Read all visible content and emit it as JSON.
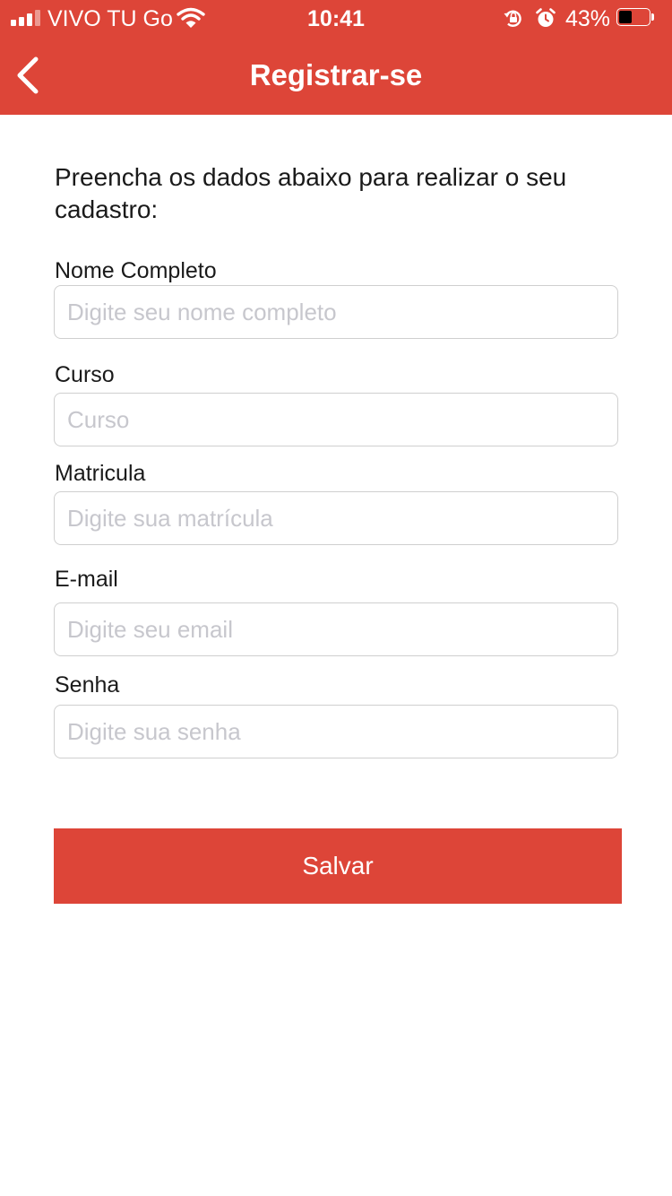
{
  "status_bar": {
    "carrier": "VIVO TU Go",
    "time": "10:41",
    "battery_percent": "43%",
    "battery_level": 0.43,
    "signal_bars_active": 3,
    "signal_bars_total": 4,
    "icons": [
      "signal-icon",
      "wifi-icon",
      "rotation-lock-icon",
      "alarm-icon",
      "battery-icon"
    ]
  },
  "nav": {
    "title": "Registrar-se",
    "back_icon": "chevron-left-icon"
  },
  "form": {
    "intro": "Preencha os dados abaixo para realizar o seu cadastro:",
    "fields": [
      {
        "label": "Nome Completo",
        "placeholder": "Digite seu nome completo",
        "value": ""
      },
      {
        "label": "Curso",
        "placeholder": "Curso",
        "value": ""
      },
      {
        "label": "Matricula",
        "placeholder": "Digite sua matrícula",
        "value": ""
      },
      {
        "label": "E-mail",
        "placeholder": "Digite seu email",
        "value": ""
      },
      {
        "label": "Senha",
        "placeholder": "Digite sua senha",
        "value": ""
      }
    ],
    "save_label": "Salvar"
  },
  "colors": {
    "accent": "#dd4538",
    "text": "#1a1a1a",
    "placeholder": "#c7c7cd",
    "input_border": "#cfcfcf"
  }
}
